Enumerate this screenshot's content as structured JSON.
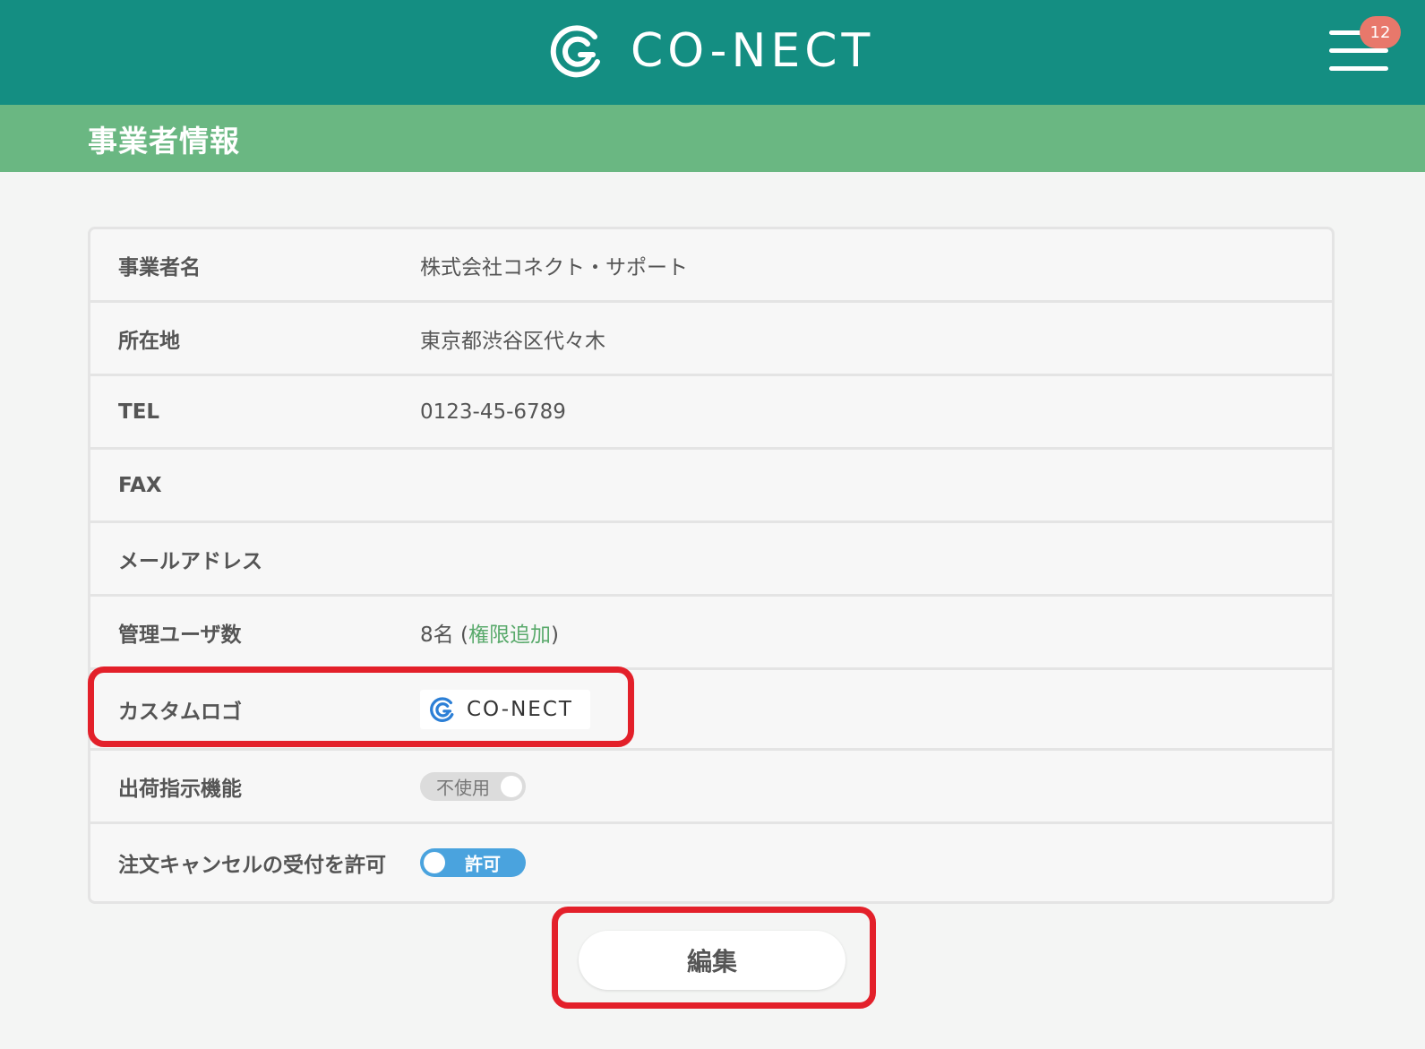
{
  "header": {
    "brand": "CO-NECT",
    "notification_count": "12",
    "colors": {
      "header_bg": "#148e82",
      "subbar_bg": "#6ab782",
      "badge": "#e8786b"
    },
    "icons": {
      "brand": "conect-logo-icon",
      "menu": "hamburger-menu-icon"
    }
  },
  "page": {
    "title": "事業者情報"
  },
  "rows": [
    {
      "label": "事業者名",
      "value": "株式会社コネクト・サポート"
    },
    {
      "label": "所在地",
      "value": "東京都渋谷区代々木"
    },
    {
      "label": "TEL",
      "value": "0123-45-6789"
    },
    {
      "label": "FAX",
      "value": ""
    },
    {
      "label": "メールアドレス",
      "value": ""
    },
    {
      "label": "管理ユーザ数",
      "count": "8名",
      "open_paren": " (",
      "link": "権限追加",
      "close_paren": ")"
    },
    {
      "label": "カスタムロゴ",
      "logo_text": "CO-NECT"
    },
    {
      "label": "出荷指示機能",
      "toggle": "不使用",
      "toggle_state": "off"
    },
    {
      "label": "注文キャンセルの受付を許可",
      "toggle": "許可",
      "toggle_state": "on",
      "toggle_color": "#4aa3de"
    }
  ],
  "actions": {
    "edit_label": "編集"
  },
  "annotations": {
    "highlight_color": "#e3202a"
  }
}
